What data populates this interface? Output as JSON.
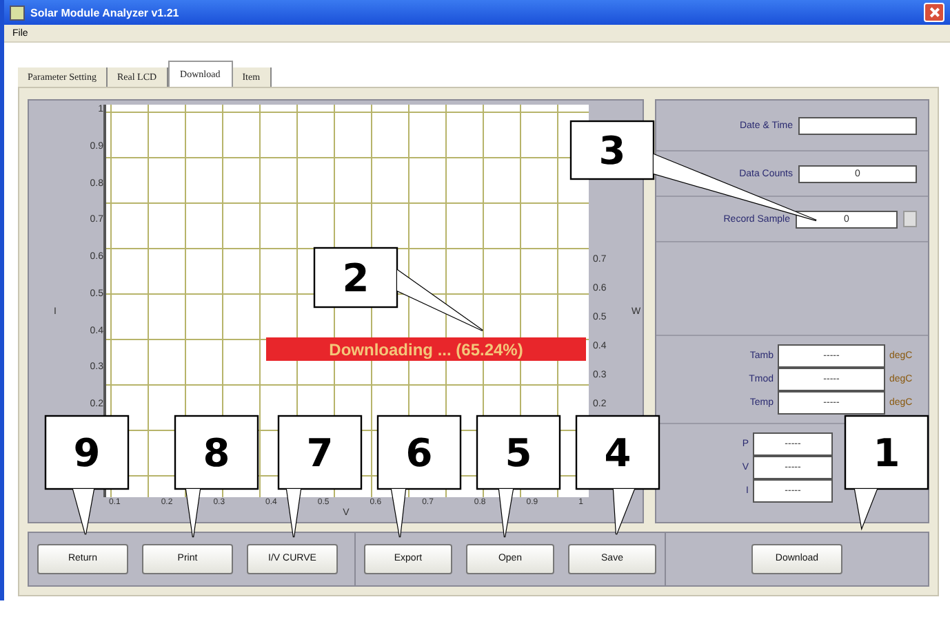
{
  "window": {
    "title": "Solar Module Analyzer v1.21"
  },
  "menu": [
    "File"
  ],
  "tabs": [
    {
      "label": "Parameter Setting",
      "selected": false
    },
    {
      "label": "Real LCD",
      "selected": false
    },
    {
      "label": "Download",
      "selected": true
    },
    {
      "label": "Item",
      "selected": false
    }
  ],
  "chart": {
    "y_label": "I",
    "left_ticks": [
      "1",
      "0.9",
      "0.8",
      "0.7",
      "0.6",
      "0.5",
      "0.4",
      "0.3",
      "0.2"
    ],
    "right_label": "W",
    "right_ticks": [
      "0.7",
      "0.6",
      "0.5",
      "0.4",
      "0.3",
      "0.2"
    ],
    "x_label": "V",
    "x_ticks": [
      "0.1",
      "0.2",
      "0.3",
      "0.4",
      "0.5",
      "0.6",
      "0.7",
      "0.8",
      "0.9",
      "1"
    ],
    "status": "Downloading ... (65.24%)"
  },
  "side": {
    "fields": [
      {
        "kind": "text",
        "label": "Date & Time"
      },
      {
        "kind": "text",
        "label": "Data Counts",
        "value": "0"
      },
      {
        "kind": "spin",
        "label": "Record Sample",
        "value": "0"
      }
    ],
    "temperatures": [
      {
        "label": "Tamb",
        "value": "-----",
        "unit": "degC"
      },
      {
        "label": "Tmod",
        "value": "-----",
        "unit": "degC"
      },
      {
        "label": "Temp",
        "value": "-----",
        "unit": "degC"
      }
    ],
    "readings": [
      {
        "label": "P",
        "value": "-----"
      },
      {
        "label": "V",
        "value": "-----"
      },
      {
        "label": "I",
        "value": "-----"
      }
    ]
  },
  "button_groups": [
    [
      "Return",
      "Print",
      "I/V CURVE"
    ],
    [
      "Export",
      "Open",
      "Save"
    ],
    [
      "Download"
    ]
  ],
  "callouts": [
    "3",
    "2",
    "9",
    "8",
    "7",
    "6",
    "5",
    "4",
    "1"
  ]
}
